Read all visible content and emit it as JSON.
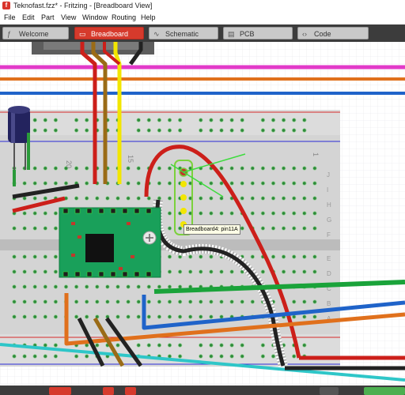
{
  "window": {
    "title": "Teknofast.fzz* - Fritzing - [Breadboard View]",
    "app_icon": "f"
  },
  "menu": [
    "File",
    "Edit",
    "Part",
    "View",
    "Window",
    "Routing",
    "Help"
  ],
  "tabs": [
    {
      "label": "Welcome",
      "icon": "fritzing-f-icon",
      "active": false
    },
    {
      "label": "Breadboard",
      "icon": "breadboard-icon",
      "active": true
    },
    {
      "label": "Schematic",
      "icon": "schematic-icon",
      "active": false
    },
    {
      "label": "PCB",
      "icon": "pcb-icon",
      "active": false
    },
    {
      "label": "Code",
      "icon": "code-icon",
      "active": false
    }
  ],
  "breadboard": {
    "column_labels": [
      "20",
      "15",
      "1"
    ],
    "row_labels_top": [
      "J",
      "I",
      "H",
      "G",
      "F"
    ],
    "row_labels_bottom": [
      "E",
      "D",
      "C",
      "B",
      "A"
    ],
    "tooltip": "Breadboard4: pin11A"
  },
  "colors": {
    "accent_tab": "#d63a2c",
    "wire_red": "#cc1f1a",
    "wire_black": "#222222",
    "wire_yellow": "#f2e600",
    "wire_brown": "#9a6b16",
    "wire_green": "#1aa33a",
    "wire_blue": "#1f63c9",
    "wire_orange": "#e0701c",
    "wire_cyan": "#2ec6c8",
    "rail_magenta": "#e23ac9",
    "pcb_green": "#19a05a"
  }
}
